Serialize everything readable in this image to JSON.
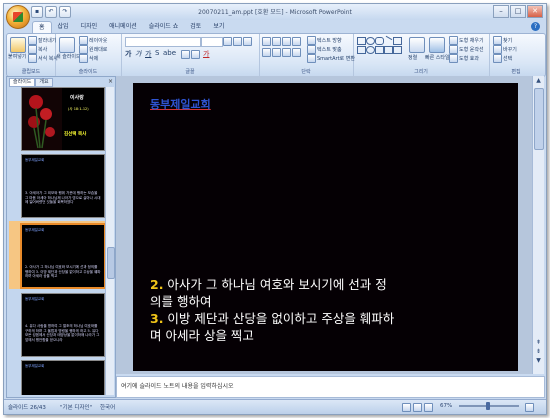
{
  "window": {
    "title": "20070211_am.ppt [호환 모드] - Microsoft PowerPoint",
    "controls": [
      "–",
      "□",
      "✕"
    ]
  },
  "ribbon": {
    "tabs": [
      "홈",
      "삽입",
      "디자인",
      "애니메이션",
      "슬라이드 쇼",
      "검토",
      "보기"
    ],
    "active_tab": "홈",
    "clipboard": {
      "label": "클립보드",
      "paste": "붙여넣기",
      "cut": "잘라내기",
      "copy": "복사",
      "format_painter": "서식 복사"
    },
    "slides": {
      "label": "슬라이드",
      "new_slide": "새 슬라이드",
      "layout": "레이아웃",
      "reset": "원래대로",
      "delete": "삭제"
    },
    "font": {
      "label": "글꼴",
      "font_name": "",
      "font_size": ""
    },
    "paragraph": {
      "label": "단락",
      "text_direction": "텍스트 방향",
      "align_text": "텍스트 맞춤",
      "smartart": "SmartArt로 변환"
    },
    "drawing": {
      "label": "그리기",
      "arrange": "정렬",
      "quick_styles": "빠른 스타일",
      "shape_fill": "도형 채우기",
      "shape_outline": "도형 윤곽선",
      "shape_effects": "도형 효과"
    },
    "editing": {
      "label": "편집",
      "find": "찾기",
      "replace": "바꾸기",
      "select": "선택"
    }
  },
  "panel": {
    "tabs": [
      "슬라이드",
      "개요"
    ],
    "close": "×"
  },
  "thumbnails": [
    {
      "num": "",
      "title": "이사랑",
      "sub": "(사 18:1-12)",
      "name": "김선택 목사"
    },
    {
      "num": "",
      "header": "동부제일교회",
      "text": "3. 아세아가 그 외모와 행위 가운데 행하는 모습을 그 마음 아세아 하나님께 나아가 영으로 살아나 시대에 잃어버렸던 것들을 회복하였다"
    },
    {
      "num": "",
      "header": "동부제일교회",
      "text": "2. 아사가 그 하나님 여호와 보시기에 선과 정의를 행하여 3. 이방 제단과 산당을 없이하고 주상을 훼파하며 아세라 상을 찍고"
    },
    {
      "num": "",
      "header": "동부제일교회",
      "text": "4. 유다 사람을 명하여 그 열조의 하나님 여호와를 구하게 하며 그 율법과 명령을 행하게 하고 5. 유다 모든 성읍에서 산당과 태양상을 없이하매 나라가 그 앞에서 평안함을 얻으니라"
    },
    {
      "num": "",
      "header": "동부제일교회",
      "text": ""
    }
  ],
  "slide": {
    "title": "동부제일교회",
    "lines": [
      {
        "num": "2.",
        "text": " 아사가 그 하나님 여호와 보시기에 선과 정"
      },
      {
        "num": "",
        "text": "의를 행하여"
      },
      {
        "num": "3.",
        "text": " 이방 제단과 산당을 없이하고 주상을 훼파하"
      },
      {
        "num": "",
        "text": "며 아세라 상을 찍고"
      }
    ]
  },
  "notes": {
    "placeholder": "여기에 슬라이드 노트의 내용을 입력하십시오"
  },
  "status": {
    "slide_info": "슬라이드 26/43",
    "theme": "\"기본 디자인\"",
    "language": "한국어",
    "zoom": "67%"
  },
  "colors": {
    "accent": "#f0c419",
    "title": "#2f55d4",
    "slide_bg": "#050004"
  }
}
